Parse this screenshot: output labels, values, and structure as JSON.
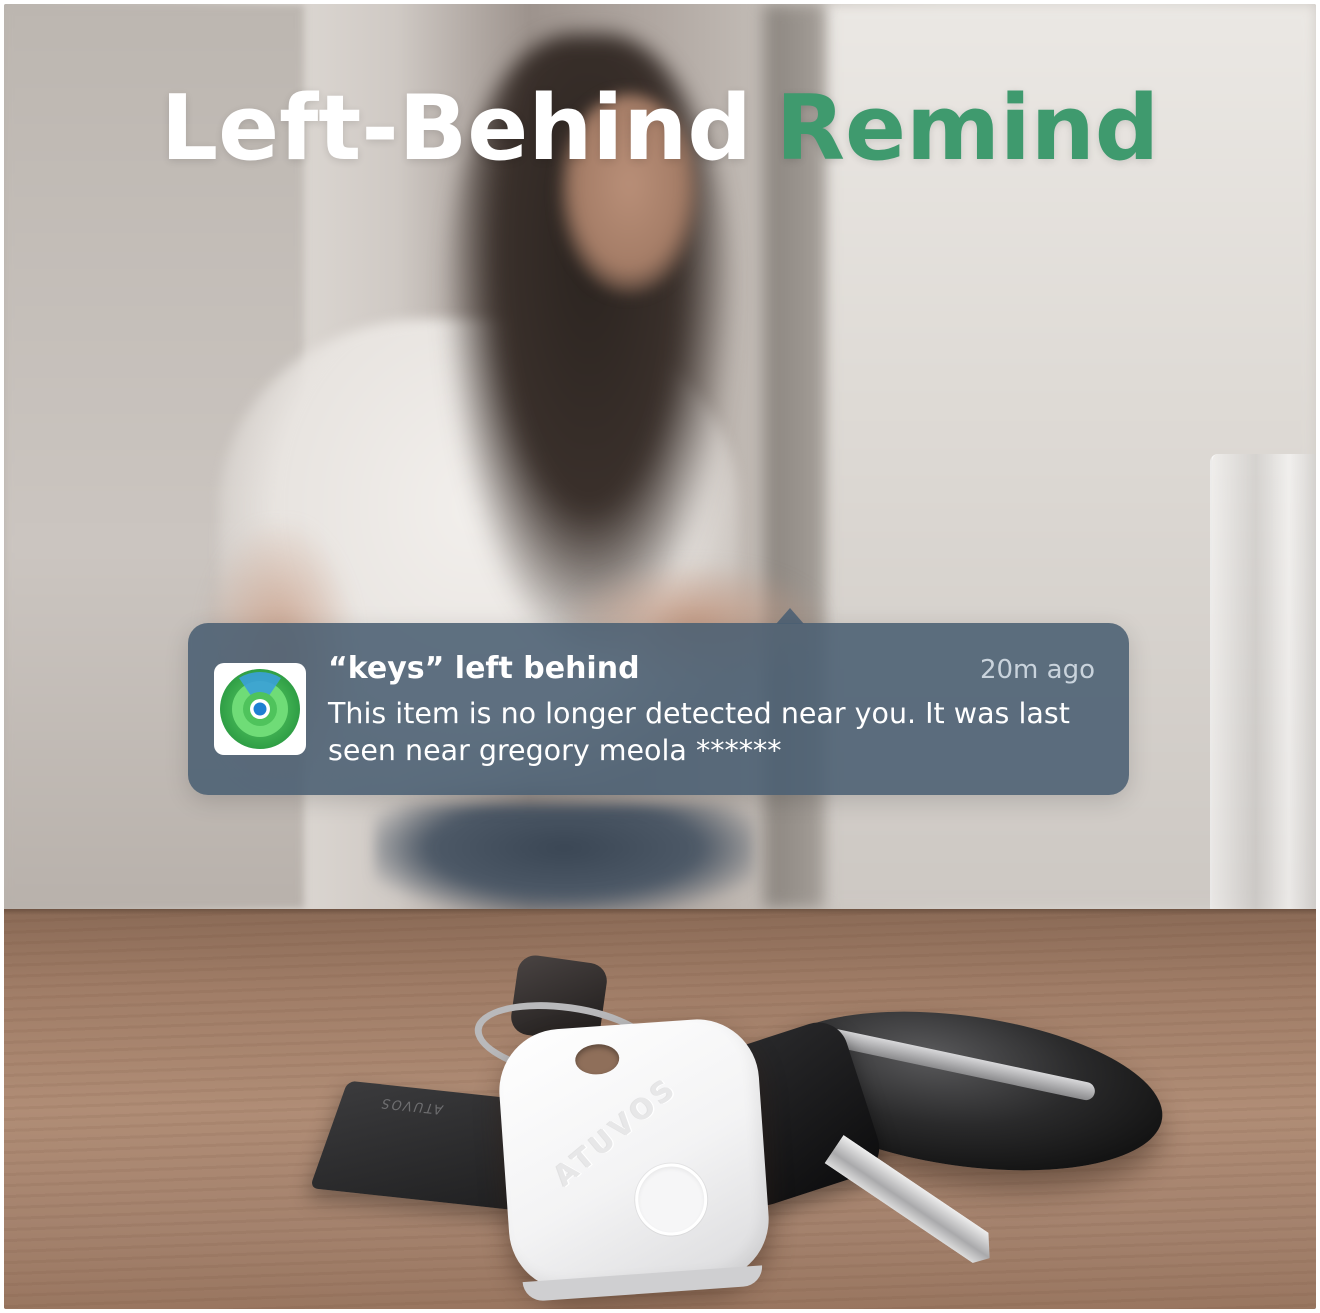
{
  "headline": {
    "part1": "Left-Behind",
    "part2": "Remind",
    "accent_color": "#3f9a6e"
  },
  "notification": {
    "app_icon": "find-my-radar-icon",
    "title": "“keys” left behind",
    "time": "20m ago",
    "body": "This item is no longer detected near you. It was last seen near  gregory meola ******"
  },
  "product": {
    "brand": "ATUVOS"
  }
}
